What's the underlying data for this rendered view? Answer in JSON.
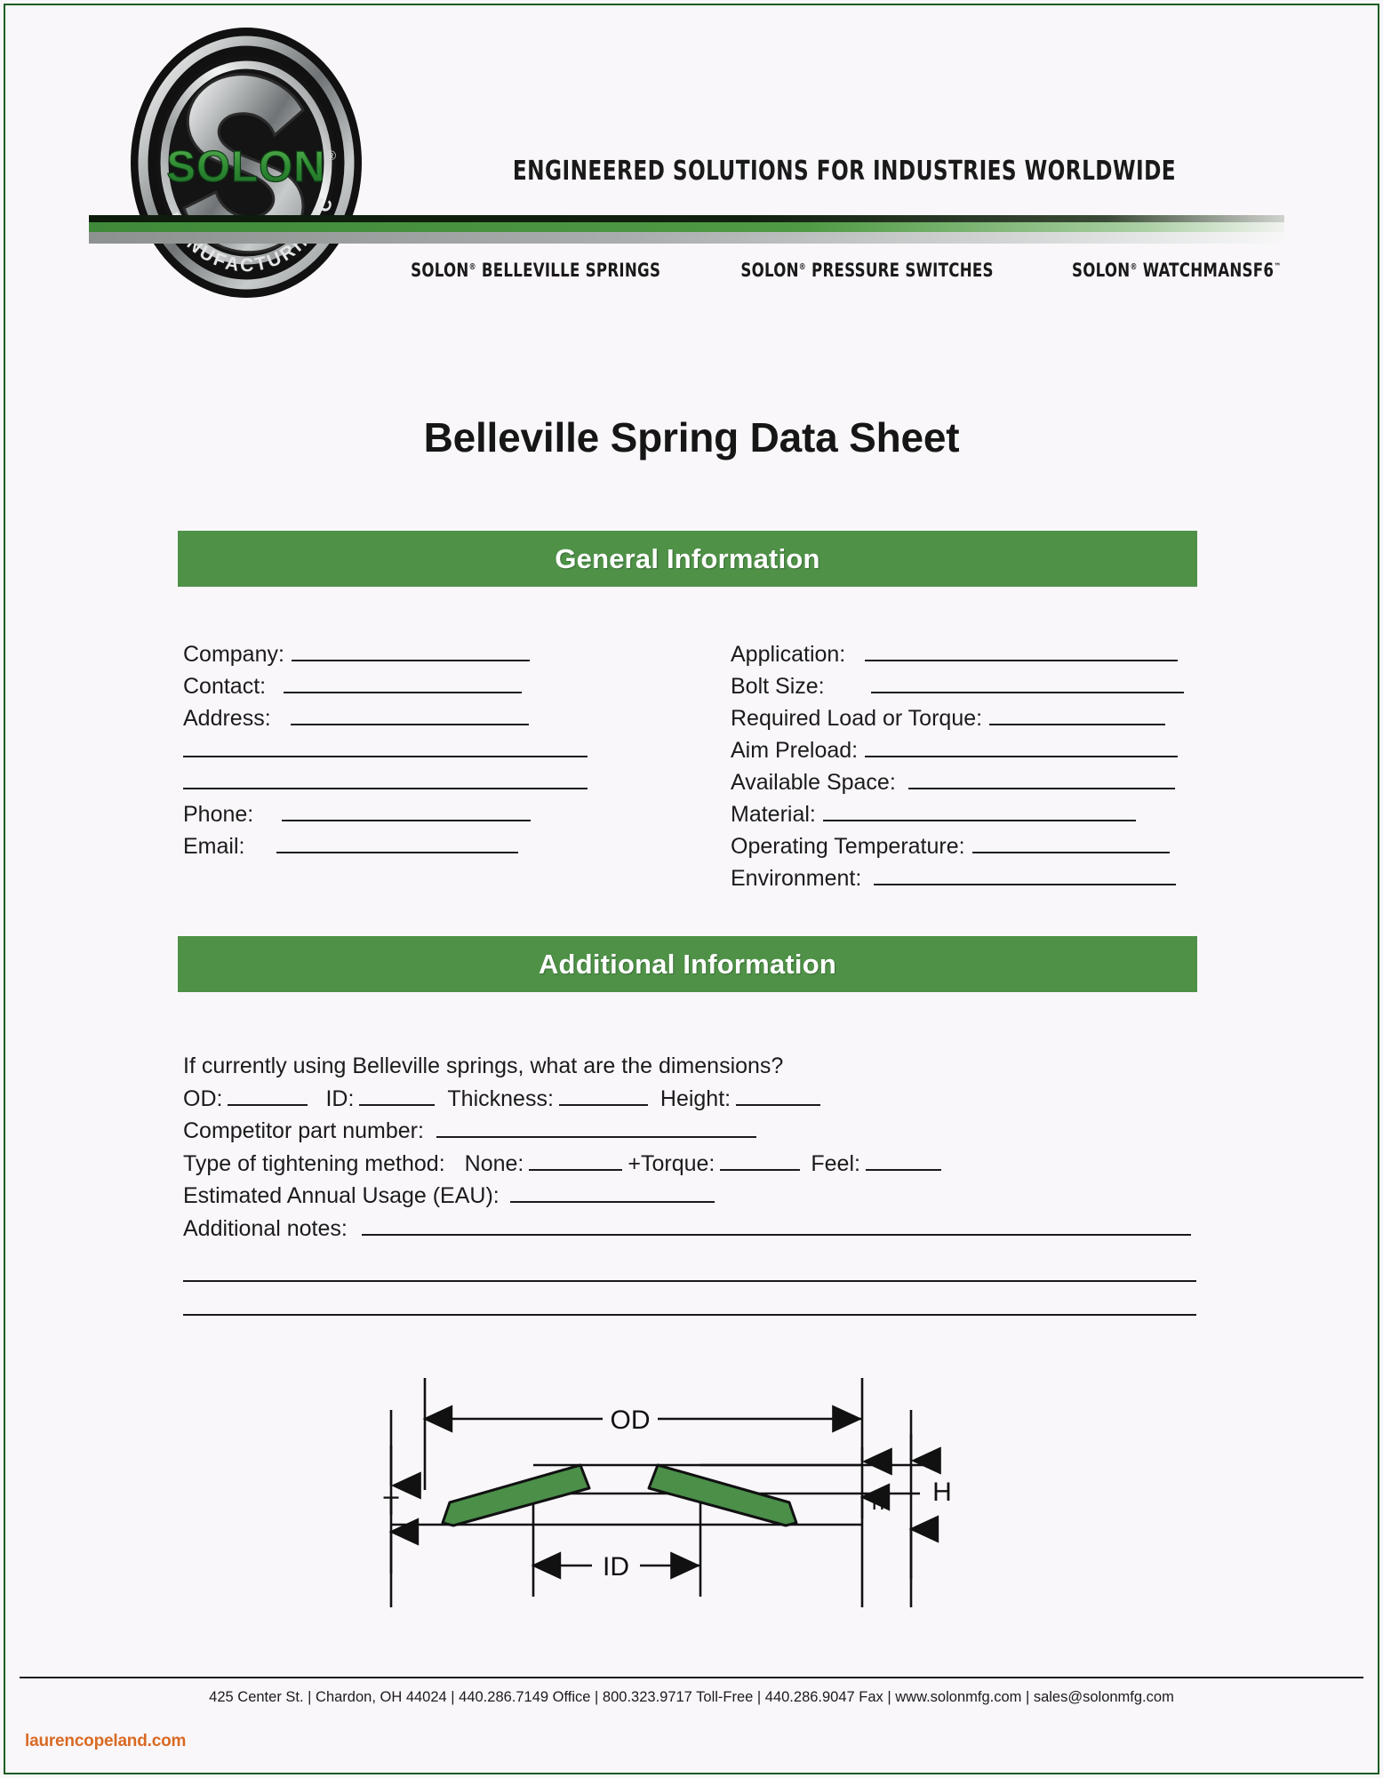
{
  "header": {
    "logo": {
      "brand": "SOLON",
      "registered": "®",
      "ring_text": "MANUFACTURING CO."
    },
    "tagline": "ENGINEERED SOLUTIONS FOR INDUSTRIES WORLDWIDE",
    "products": [
      {
        "brand": "SOLON",
        "mark": "®",
        "name": "BELLEVILLE SPRINGS"
      },
      {
        "brand": "SOLON",
        "mark": "®",
        "name": "PRESSURE SWITCHES"
      },
      {
        "brand": "SOLON",
        "mark": "®",
        "name": "WATCHMANSF6",
        "trailing_mark": "™"
      }
    ]
  },
  "title": "Belleville Spring Data Sheet",
  "sections": {
    "general": {
      "banner": "General Information",
      "left_fields": [
        {
          "label": "Company:",
          "value": "",
          "line_width": 268
        },
        {
          "label": "Contact:",
          "value": "",
          "line_width": 268
        },
        {
          "label": "Address:",
          "value": "",
          "line_width": 268
        },
        {
          "label": "",
          "value": "",
          "line_width": 455
        },
        {
          "label": "",
          "value": "",
          "line_width": 455
        },
        {
          "label": "Phone:",
          "value": "",
          "line_width": 268
        },
        {
          "label": "Email:",
          "value": "",
          "line_width": 268
        }
      ],
      "right_fields": [
        {
          "label": "Application:",
          "value": "",
          "line_width": 352
        },
        {
          "label": "Bolt Size:",
          "value": "",
          "line_width": 352
        },
        {
          "label": "Required Load or Torque:",
          "value": "",
          "line_width": 198
        },
        {
          "label": "Aim Preload:",
          "value": "",
          "line_width": 352
        },
        {
          "label": "Available Space:",
          "value": "",
          "line_width": 300
        },
        {
          "label": "Material:",
          "value": "",
          "line_width": 352
        },
        {
          "label": "Operating Temperature:",
          "value": "",
          "line_width": 222
        },
        {
          "label": "Environment:",
          "value": "",
          "line_width": 340
        }
      ]
    },
    "additional": {
      "banner": "Additional Information",
      "question": "If currently using Belleville springs,  what are the dimensions?",
      "dimension_row": [
        {
          "label": "OD:",
          "line_width": 90
        },
        {
          "label": "ID:",
          "line_width": 85
        },
        {
          "label": "Thickness:",
          "line_width": 100
        },
        {
          "label": "Height:",
          "line_width": 95
        }
      ],
      "competitor_label": "Competitor part number:",
      "competitor_line_width": 360,
      "tightening_label": "Type of tightening method:",
      "tightening_options": [
        {
          "label": "None:",
          "line_width": 105
        },
        {
          "label": "+Torque:",
          "line_width": 90
        },
        {
          "label": "Feel:",
          "line_width": 85
        }
      ],
      "eau_label": "Estimated Annual Usage (EAU):",
      "eau_line_width": 230,
      "notes_label": "Additional notes:",
      "notes_line_width": 880,
      "extra_rule_count": 2
    }
  },
  "diagram": {
    "labels": {
      "od": "OD",
      "id": "ID",
      "t": "T",
      "h_small": "h",
      "h_cap": "H"
    },
    "spring_color": "#4b8f49",
    "outline_color": "#111111"
  },
  "footer": {
    "address": "425 Center St. | Chardon, OH 44024 | 440.286.7149 Office | 800.323.9717 Toll-Free | 440.286.9047 Fax | www.solonmfg.com | sales@solonmfg.com",
    "watermark": "laurencopeland.com"
  },
  "colors": {
    "brand_green": "#4e9147",
    "spring_green": "#4b8f49",
    "text": "#1b1b1b",
    "page_bg": "#faf7fb",
    "watermark": "#d96a24"
  }
}
